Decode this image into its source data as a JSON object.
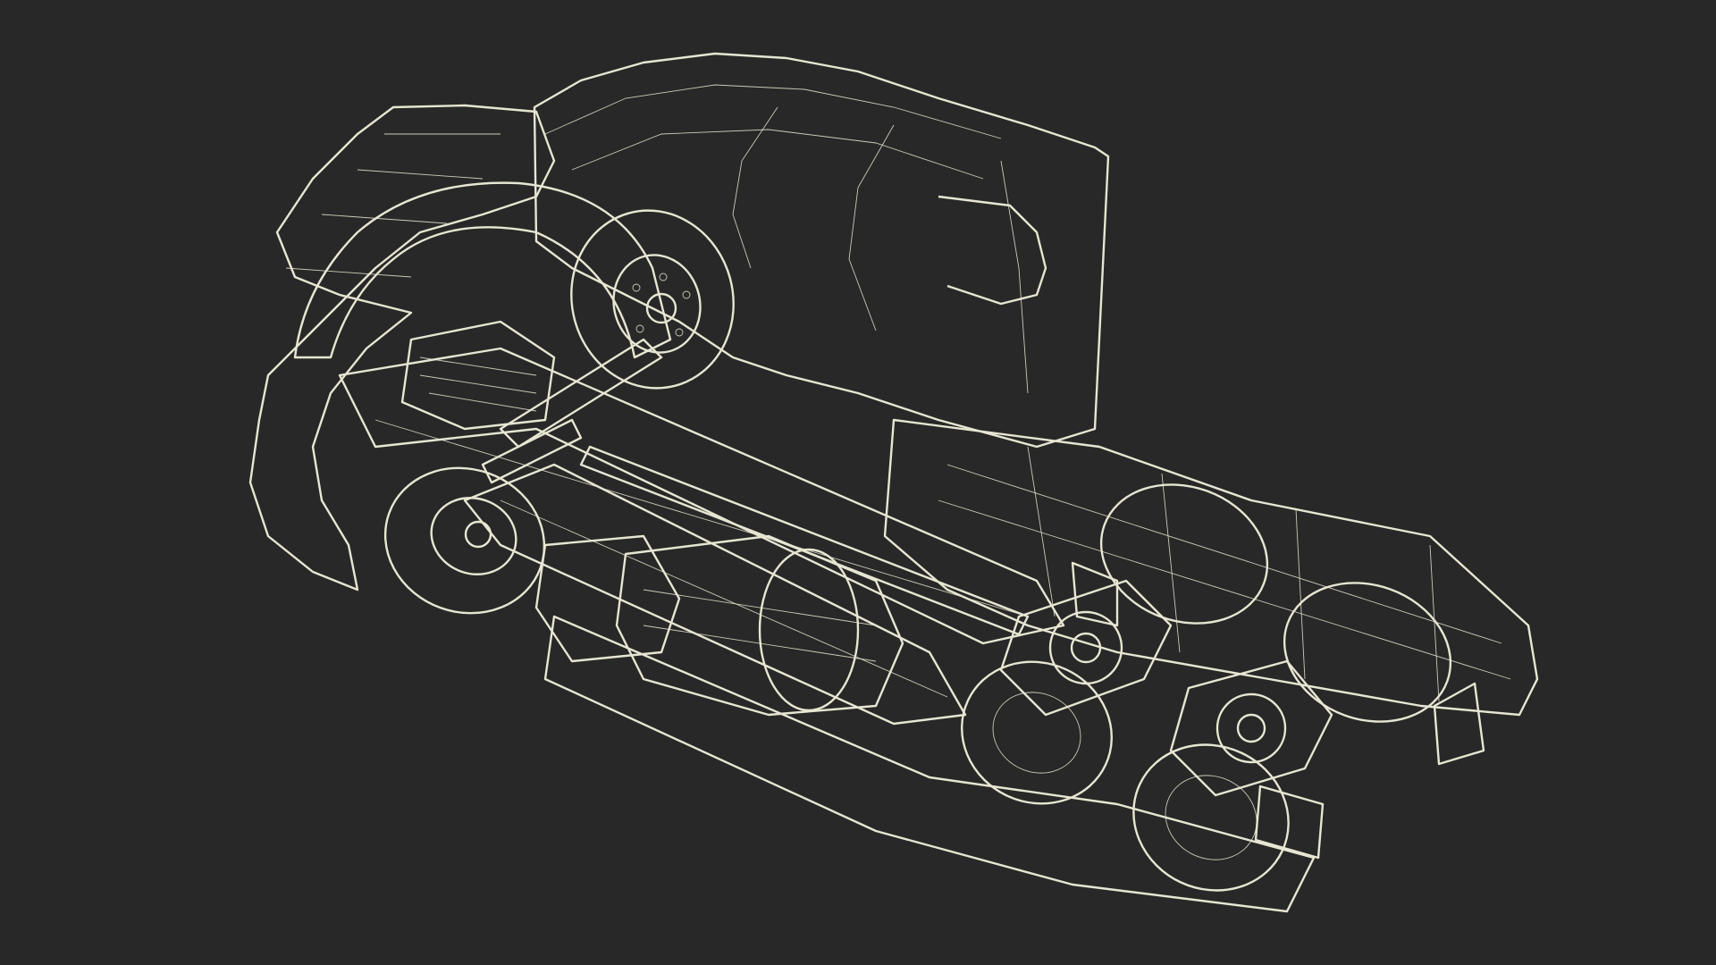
{
  "scene": {
    "subject": "wireframe-truck-underside",
    "background_color": "#282828",
    "mesh_fill_color": "#7e8174",
    "wire_color": "#e6e6d2"
  }
}
